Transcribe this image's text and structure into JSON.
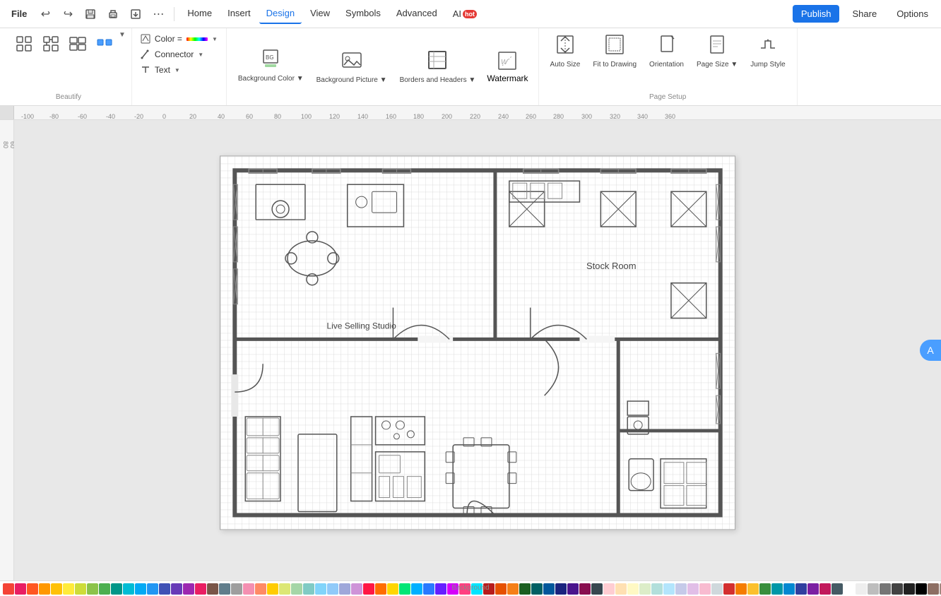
{
  "app": {
    "file_label": "File",
    "undo_icon": "↩",
    "redo_icon": "↪",
    "save_icon": "💾",
    "print_icon": "🖨",
    "export_icon": "↗",
    "more_icon": "⋯"
  },
  "nav": {
    "items": [
      "Home",
      "Insert",
      "Design",
      "View",
      "Symbols",
      "Advanced"
    ],
    "active": "Design",
    "ai_label": "AI",
    "ai_badge": "hot"
  },
  "header_right": {
    "publish": "Publish",
    "share": "Share",
    "options": "Options"
  },
  "beautify": {
    "label": "Beautify"
  },
  "cct": {
    "color_label": "Color",
    "color_eq": "Color =",
    "connector_label": "Connector",
    "text_label": "Text"
  },
  "background": {
    "label": "Background",
    "bg_color_label": "Background Color",
    "bg_picture_label": "Background Picture",
    "borders_label": "Borders and Headers",
    "watermark_label": "Watermark"
  },
  "page_setup": {
    "label": "Page Setup",
    "auto_size_label": "Auto Size",
    "fit_drawing_label": "Fit to Drawing",
    "orientation_label": "Orientation",
    "page_size_label": "Page Size",
    "jump_style_label": "Jump Style"
  },
  "drawing": {
    "stock_room_label": "Stock Room",
    "live_selling_label": "Live Selling Studio"
  },
  "colors": [
    "#f44336",
    "#e91e63",
    "#ff5722",
    "#ff9800",
    "#ffc107",
    "#ffeb3b",
    "#cddc39",
    "#8bc34a",
    "#4caf50",
    "#009688",
    "#00bcd4",
    "#03a9f4",
    "#2196f3",
    "#3f51b5",
    "#673ab7",
    "#9c27b0",
    "#e91e63",
    "#795548",
    "#607d8b",
    "#9e9e9e",
    "#f48fb1",
    "#ff8a65",
    "#ffcc02",
    "#dce775",
    "#a5d6a7",
    "#80cbc4",
    "#81d4fa",
    "#90caf9",
    "#9fa8da",
    "#ce93d8",
    "#ff1744",
    "#ff6d00",
    "#ffd600",
    "#00e676",
    "#00b0ff",
    "#2979ff",
    "#651fff",
    "#d500f9",
    "#ff4081",
    "#00e5ff",
    "#b71c1c",
    "#e65100",
    "#f57f17",
    "#1b5e20",
    "#006064",
    "#01579b",
    "#1a237e",
    "#4a148c",
    "#880e4f",
    "#37474f",
    "#ffcdd2",
    "#ffe0b2",
    "#fff9c4",
    "#dcedc8",
    "#b2dfdb",
    "#b3e5fc",
    "#c5cae9",
    "#e1bee7",
    "#f8bbd0",
    "#cfd8dc",
    "#d32f2f",
    "#f57c00",
    "#fbc02d",
    "#388e3c",
    "#0097a7",
    "#0288d1",
    "#303f9f",
    "#7b1fa2",
    "#c2185b",
    "#455a64",
    "#ffffff",
    "#eeeeee",
    "#bdbdbd",
    "#757575",
    "#424242",
    "#212121",
    "#000000",
    "#8d6e63",
    "#a1887f",
    "#bcaaa4"
  ]
}
